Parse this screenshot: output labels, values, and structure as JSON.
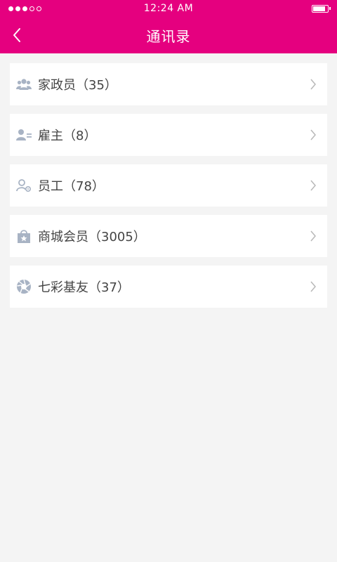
{
  "status_bar": {
    "time": "12:24 AM",
    "signal_filled": 3,
    "signal_total": 5,
    "battery_level": 0.85
  },
  "header": {
    "title": "通讯录",
    "back_icon": "chevron-left-icon"
  },
  "contacts": [
    {
      "label": "家政员（35）",
      "icon": "group-icon"
    },
    {
      "label": "雇主（8）",
      "icon": "employer-card-icon"
    },
    {
      "label": "员工（78）",
      "icon": "staff-gear-icon"
    },
    {
      "label": "商城会员（3005）",
      "icon": "shop-bag-icon"
    },
    {
      "label": "七彩基友（37）",
      "icon": "aperture-icon"
    }
  ],
  "colors": {
    "brand": "#e5007f",
    "background": "#f4f4f4",
    "icon_gray": "#a8b3c4"
  }
}
